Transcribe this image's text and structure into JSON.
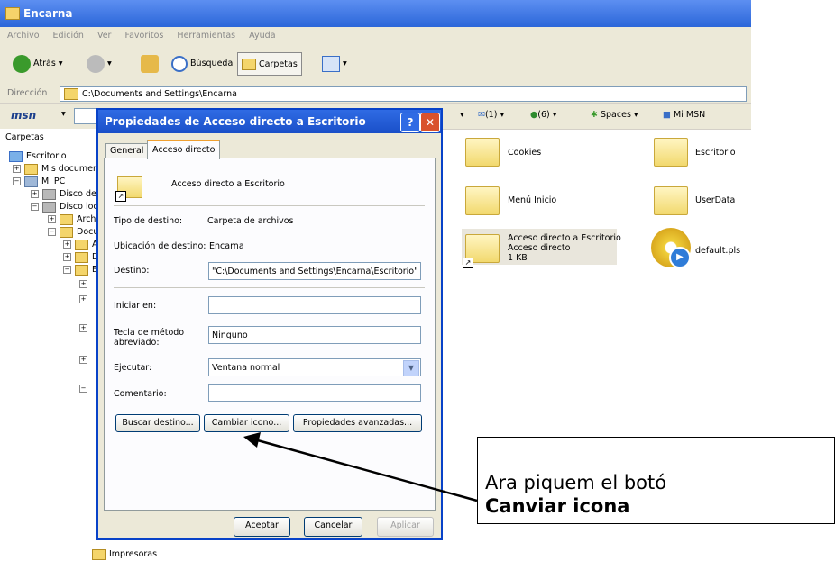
{
  "window": {
    "title": "Encarna"
  },
  "menu": [
    "Archivo",
    "Edición",
    "Ver",
    "Favoritos",
    "Herramientas",
    "Ayuda"
  ],
  "toolbar": {
    "back": "Atrás",
    "search": "Búsqueda",
    "folders": "Carpetas"
  },
  "address": {
    "label": "Dirección",
    "value": "C:\\Documents and Settings\\Encarna"
  },
  "msn": {
    "logo": "msn",
    "mail": "(1)",
    "contacts": "(6)",
    "spaces": "Spaces",
    "mymsn": "Mi MSN",
    "counter_left": ")"
  },
  "tree": {
    "header": "Carpetas",
    "items": [
      "Escritorio",
      "Mis document",
      "Mi PC",
      "Disco de",
      "Disco loca",
      "Archi",
      "Docu",
      "A",
      "D",
      "E",
      "Impresoras"
    ]
  },
  "files": [
    {
      "name": "Cookies"
    },
    {
      "name": "Escritorio"
    },
    {
      "name": "Menú Inicio"
    },
    {
      "name": "UserData"
    },
    {
      "name": "Acceso directo a Escritorio",
      "line2": "Acceso directo",
      "line3": "1 KB"
    },
    {
      "name": "default.pls"
    }
  ],
  "dialog": {
    "title": "Propiedades de Acceso directo a Escritorio",
    "tabs": [
      "General",
      "Acceso directo"
    ],
    "name": "Acceso directo a Escritorio",
    "fields": {
      "target_type_label": "Tipo de destino:",
      "target_type": "Carpeta de archivos",
      "target_loc_label": "Ubicación de destino:",
      "target_loc": "Encarna",
      "target_label": "Destino:",
      "target": "\"C:\\Documents and Settings\\Encarna\\Escritorio\"",
      "start_label": "Iniciar en:",
      "start": "",
      "hotkey_label": "Tecla de método abreviado:",
      "hotkey": "Ninguno",
      "run_label": "Ejecutar:",
      "run": "Ventana normal",
      "comment_label": "Comentario:",
      "comment": ""
    },
    "buttons": {
      "find": "Buscar destino...",
      "change_icon": "Cambiar icono...",
      "advanced": "Propiedades avanzadas...",
      "ok": "Aceptar",
      "cancel": "Cancelar",
      "apply": "Aplicar"
    }
  },
  "callout": {
    "line1": "Ara piquem el botó",
    "line2": "Canviar icona"
  }
}
